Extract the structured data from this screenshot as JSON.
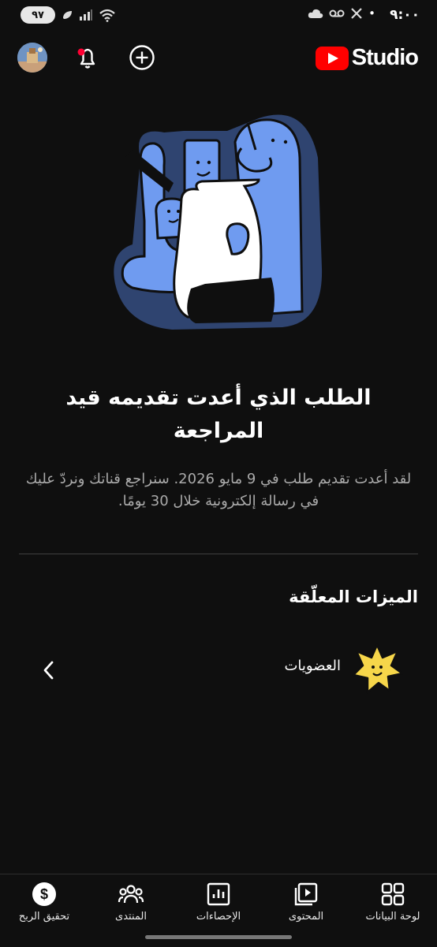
{
  "status_bar": {
    "time": "٩:٠٠",
    "battery": "٩٧"
  },
  "header": {
    "logo_text": "Studio"
  },
  "review": {
    "title": "الطلب الذي أعدت تقديمه قيد المراجعة",
    "body": "لقد أعدت تقديم طلب في 9 مايو 2026. سنراجع قناتك ونردّ عليك في رسالة إلكترونية خلال 30 يومًا."
  },
  "pending": {
    "section_title": "الميزات المعلّقة",
    "items": [
      {
        "label": "العضويات"
      }
    ]
  },
  "bottom_nav": {
    "items": [
      {
        "label": "لوحة البيانات",
        "icon": "dashboard-icon"
      },
      {
        "label": "المحتوى",
        "icon": "content-icon"
      },
      {
        "label": "الإحصاءات",
        "icon": "analytics-icon"
      },
      {
        "label": "المنتدى",
        "icon": "community-icon"
      },
      {
        "label": "تحقيق الربح",
        "icon": "earn-icon"
      }
    ]
  },
  "colors": {
    "background": "#0f0f0f",
    "youtube_red": "#ff0000",
    "illustration_blue": "#6f9bf0",
    "illustration_outline": "#2f4470",
    "badge_yellow": "#f6d64a"
  }
}
